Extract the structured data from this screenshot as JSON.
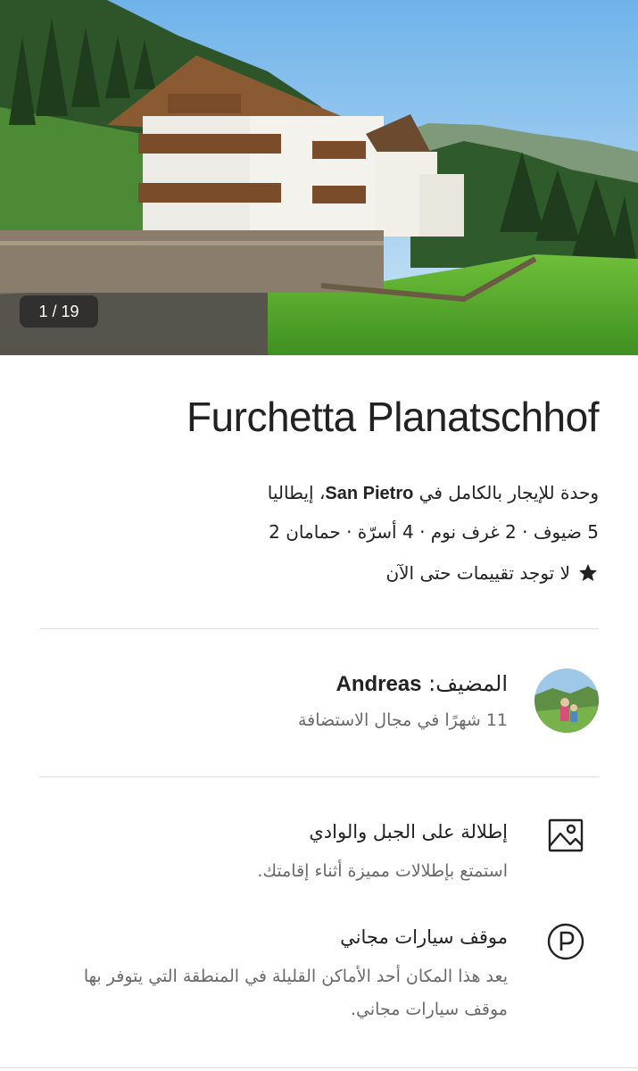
{
  "gallery": {
    "counter": "1 / 19"
  },
  "listing": {
    "title": "Furchetta Planatschhof",
    "subtitle_prefix": "وحدة للإيجار بالكامل في ",
    "subtitle_place": "San Pietro",
    "subtitle_suffix": "، إيطاليا",
    "details": "5 ضيوف · 2 غرف نوم · 4 أسرّة · حمامان 2",
    "rating_text": "لا توجد تقييمات حتى الآن",
    "rating_icon": "star-icon"
  },
  "host": {
    "label": "المضيف: ",
    "name": "Andreas",
    "experience": "11 شهرًا في مجال الاستضافة"
  },
  "features": [
    {
      "icon": "picture-icon",
      "title": "إطلالة على الجبل والوادي",
      "description": "استمتع بإطلالات مميزة أثناء إقامتك."
    },
    {
      "icon": "parking-icon",
      "title": "موقف سيارات مجاني",
      "description": "يعد هذا المكان أحد الأماكن القليلة في المنطقة التي يتوفر بها موقف سيارات مجاني."
    }
  ],
  "colors": {
    "text_primary": "#222222",
    "text_secondary": "#6a6a6a",
    "divider": "#dddddd"
  }
}
